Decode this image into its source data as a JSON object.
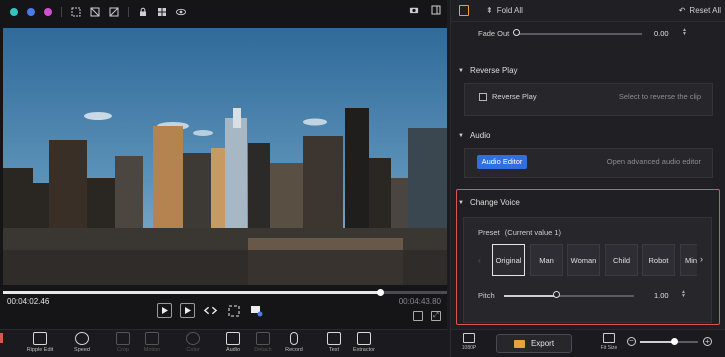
{
  "preview": {
    "toolbar_icons": [
      "color-dot-teal-icon",
      "color-dot-blue-icon",
      "color-dot-magenta-icon",
      "crop-select-icon",
      "crop-grid-icon",
      "crop-diagonal-icon",
      "lock-icon",
      "grid-icon",
      "eye-icon"
    ],
    "dot_colors": [
      "#32c5c0",
      "#4a7be8",
      "#d24fd0"
    ],
    "timecode_current": "00:04:02.46",
    "timecode_total": "00:04:43.80",
    "progress": 0.85
  },
  "toolbar": {
    "tools": [
      {
        "label": "Ripple Edit",
        "enabled": true
      },
      {
        "label": "Speed",
        "enabled": true
      },
      {
        "label": "Crop",
        "enabled": false
      },
      {
        "label": "Motion",
        "enabled": false
      },
      {
        "label": "Color",
        "enabled": false
      },
      {
        "label": "Audio",
        "enabled": true
      },
      {
        "label": "Detach",
        "enabled": false
      },
      {
        "label": "Record",
        "enabled": true
      },
      {
        "label": "Text",
        "enabled": true
      },
      {
        "label": "Extractor",
        "enabled": true
      }
    ]
  },
  "panel": {
    "fold_all": "Fold All",
    "reset_all": "Reset All",
    "fade_out": {
      "label": "Fade Out",
      "value": "0.00",
      "level": 0
    },
    "reverse_play": {
      "title": "Reverse Play",
      "checkbox_label": "Reverse Play",
      "checked": false,
      "hint": "Select to reverse the clip"
    },
    "audio": {
      "title": "Audio",
      "button_label": "Audio Editor",
      "hint": "Open advanced audio editor"
    },
    "change_voice": {
      "title": "Change Voice",
      "preset_label": "Preset",
      "preset_current": "(Current value 1)",
      "presets": [
        "Original",
        "Man",
        "Woman",
        "Child",
        "Robot",
        "Mini"
      ],
      "selected_index": 0,
      "pitch_label": "Pitch",
      "pitch_value": "1.00",
      "pitch_level": 0.4,
      "highlight_color": "#d9574f"
    }
  },
  "footer": {
    "resolution": "1080P",
    "export_label": "Export",
    "fit_label": "Fit Size",
    "zoom_level": 0.6,
    "accent": "#e8a23b",
    "button_blue": "#2f6fe0"
  }
}
